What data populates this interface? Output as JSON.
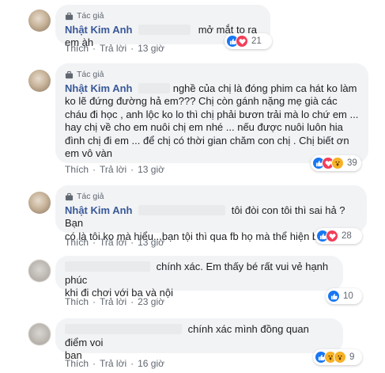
{
  "badge_label": "Tác giả",
  "actions": {
    "like": "Thích",
    "reply": "Trả lời"
  },
  "comments": [
    {
      "author": "Nhật Kim Anh",
      "has_badge": true,
      "text": "mở mắt to ra em àh",
      "reactions": [
        "like",
        "heart"
      ],
      "count": "21",
      "time": "13 giờ"
    },
    {
      "author": "Nhật Kim Anh",
      "has_badge": true,
      "line1": "nghề của chị là đóng phim ca hát ko làm",
      "lines": [
        "ko lẽ đứng đường hả em??? Chị còn gánh nặng mẹ già các",
        "cháu đi học , anh lộc ko lo thì chị phải bươn trải mà lo chứ em ...",
        "hay chị về cho em nuôi chị em nhé ... nếu được nuôi luôn hia",
        "đình chị đi em ... để chị có thời gian chăm con chị . Chị biết ơn",
        "em vô vàn"
      ],
      "reactions": [
        "like",
        "heart",
        "wow"
      ],
      "count": "39",
      "time": "13 giờ"
    },
    {
      "author": "Nhật Kim Anh",
      "has_badge": true,
      "line1": "tôi đòi con tôi thì sai hả ? Bạn",
      "lines": [
        "có là tôi ko mà hiểu...bạn tội thì qua fb họ mà thể hiện bạn nhé !"
      ],
      "reactions": [
        "like",
        "heart"
      ],
      "count": "28",
      "time": "13 giờ"
    },
    {
      "has_badge": false,
      "line1": "chính xác. Em thấy bé rất vui vẻ hạnh phúc",
      "lines": [
        "khi đi chơi với ba và nội"
      ],
      "reactions": [
        "like"
      ],
      "count": "10",
      "time": "23 giờ"
    },
    {
      "has_badge": false,
      "line1": "chính xác mình đồng quan điểm voi",
      "lines": [
        "ban"
      ],
      "reactions": [
        "like",
        "wow",
        "wow"
      ],
      "count": "9",
      "time": "16 giờ"
    }
  ]
}
